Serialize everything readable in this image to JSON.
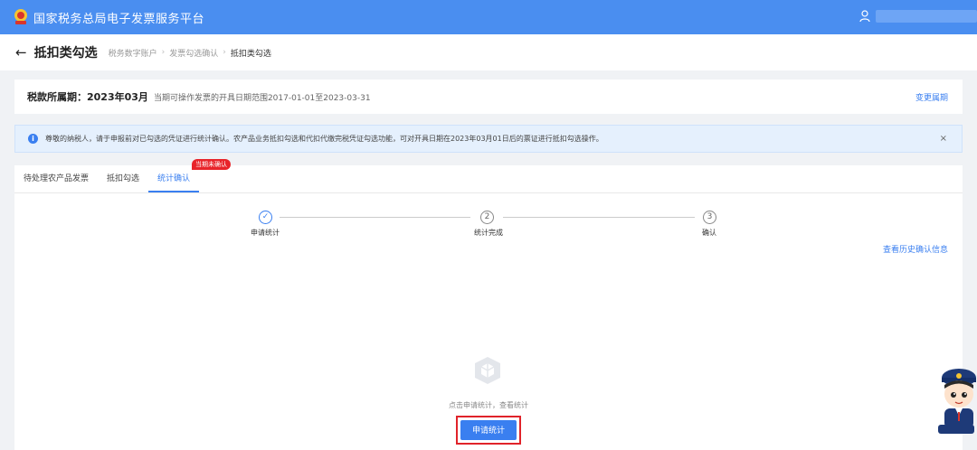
{
  "topbar": {
    "title": "国家税务总局电子发票服务平台",
    "logo_icon": "tax-emblem-icon",
    "user_icon": "user-icon",
    "background": "#4a8ef0"
  },
  "header": {
    "title": "抵扣类勾选",
    "breadcrumb": [
      "税务数字账户",
      "发票勾选确认",
      "抵扣类勾选"
    ]
  },
  "period": {
    "label": "税款所属期：",
    "value": "2023年03月",
    "range": "当期可操作发票的开具日期范围2017-01-01至2023-03-31",
    "change_link": "变更属期"
  },
  "notice": {
    "icon": "info-icon",
    "text": "尊敬的纳税人，请于申报前对已勾选的凭证进行统计确认。农产品业务抵扣勾选和代扣代缴完税凭证勾选功能，可对开具日期在2023年03月01日后的票证进行抵扣勾选操作。",
    "close": "×"
  },
  "tabs": [
    {
      "label": "待处理农产品发票",
      "active": false
    },
    {
      "label": "抵扣勾选",
      "active": false
    },
    {
      "label": "统计确认",
      "active": true,
      "badge": "当期未确认"
    }
  ],
  "steps": [
    {
      "label": "申请统计",
      "marker": "✓",
      "done": true
    },
    {
      "label": "统计完成",
      "marker": "2",
      "done": false
    },
    {
      "label": "确认",
      "marker": "3",
      "done": false
    }
  ],
  "history_link": "查看历史确认信息",
  "empty": {
    "icon": "empty-box-icon",
    "text": "点击申请统计，查看统计"
  },
  "apply_button": "申请统计",
  "accent_color": "#3a7ff0",
  "highlight_color": "#e0232a"
}
